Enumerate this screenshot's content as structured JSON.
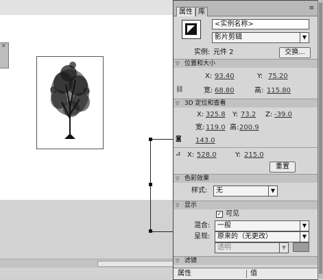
{
  "tabs": [
    {
      "label": "属性"
    },
    {
      "label": "库"
    }
  ],
  "instance": {
    "name_placeholder": "<实例名称>",
    "symbol_type": "影片剪辑",
    "instance_label": "实例:",
    "instance_of": "元件 2",
    "swap_label": "交换..."
  },
  "position_size": {
    "title": "位置和大小",
    "x_label": "X:",
    "x": "93.40",
    "y_label": "Y:",
    "y": "75.20",
    "width_label": "宽:",
    "width": "68.80",
    "height_label": "高:",
    "height": "115.80"
  },
  "threed": {
    "title": "3D 定位和查看",
    "x_label": "X:",
    "x": "325.8",
    "y_label": "Y:",
    "y": "73.2",
    "z_label": "Z:",
    "z": "-39.0",
    "width_label": "宽:",
    "width": "119.0",
    "height_label": "高:",
    "height": "200.9",
    "perspective": "143.0",
    "vp_x_label": "X:",
    "vp_x": "528.0",
    "vp_y_label": "Y:",
    "vp_y": "215.0",
    "reset_label": "重置"
  },
  "color_effect": {
    "title": "色彩效果",
    "style_label": "样式:",
    "style_value": "无"
  },
  "display": {
    "title": "显示",
    "visible_label": "可见",
    "visible": true,
    "blend_label": "混合:",
    "blend_value": "一般",
    "render_label": "呈现:",
    "render_value": "原来的（无更改）",
    "transparent_value": "透明"
  },
  "filters": {
    "title": "滤镜"
  },
  "bottom": {
    "col_property": "属性",
    "col_value": "值"
  },
  "colors": {
    "stage_bg": "#ffffff",
    "panel_bg": "#d6d6d6",
    "section_bg": "#c2c2c2"
  }
}
